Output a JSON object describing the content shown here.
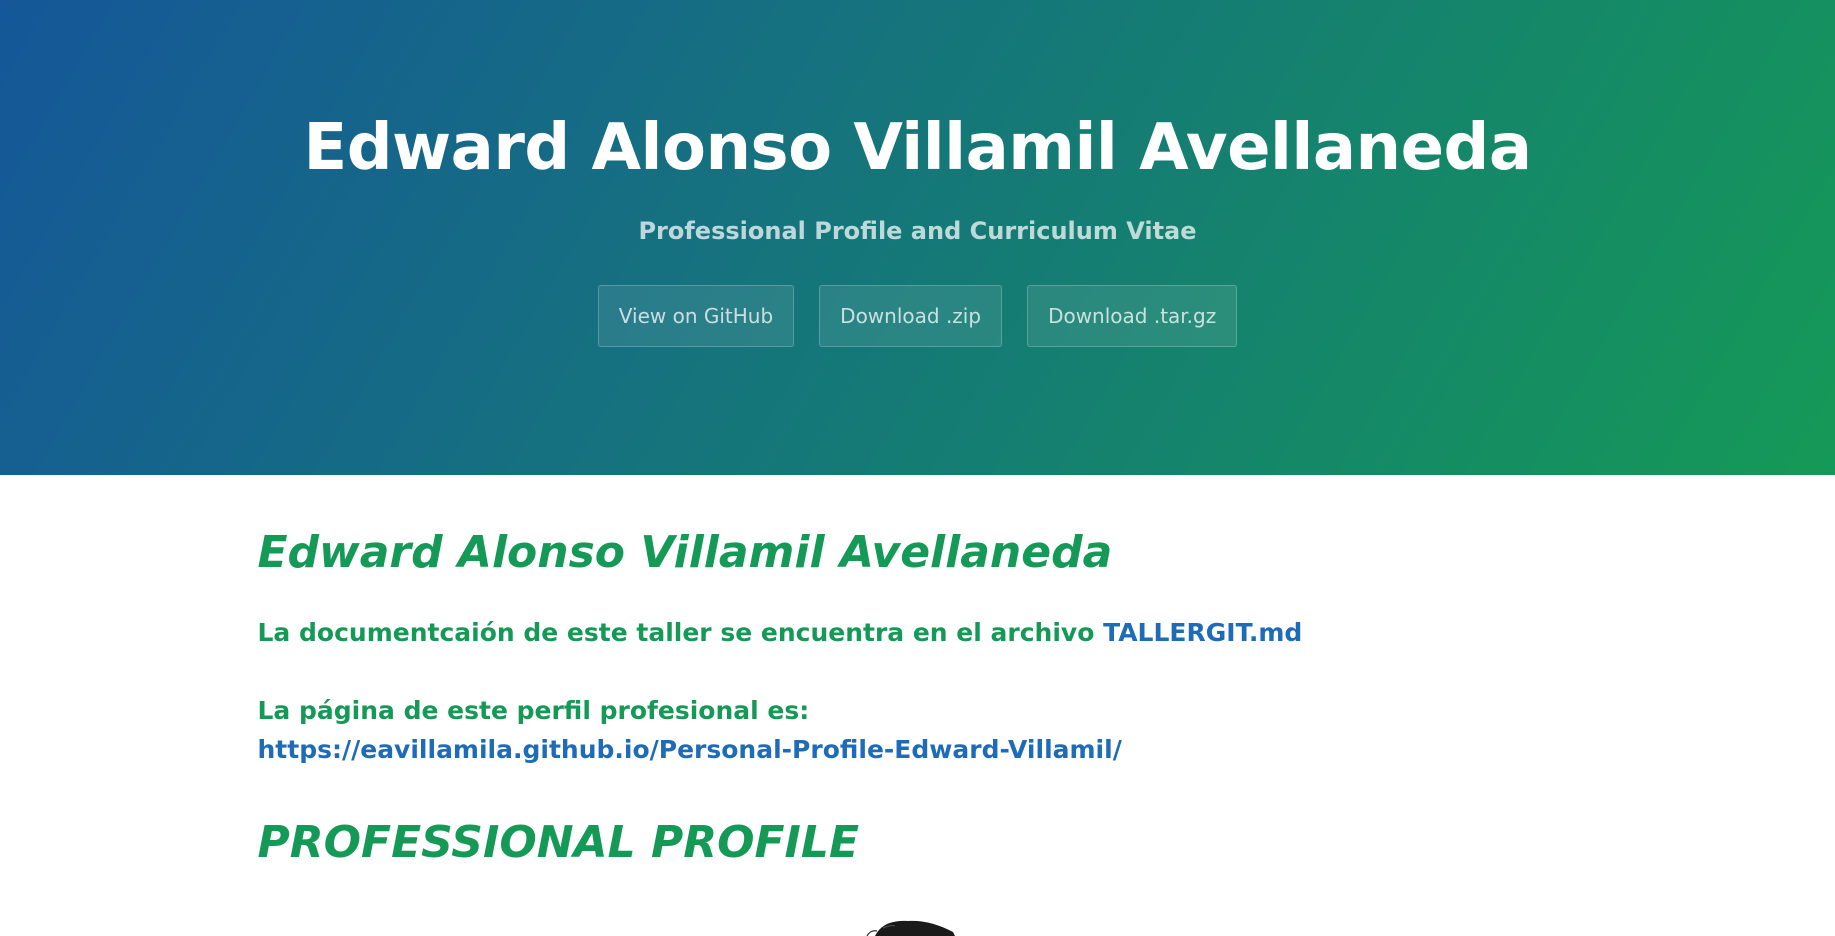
{
  "header": {
    "project_name": "Edward Alonso Villamil Avellaneda",
    "tagline": "Professional Profile and Curriculum Vitae",
    "buttons": {
      "github": "View on GitHub",
      "zip": "Download .zip",
      "targz": "Download .tar.gz"
    },
    "gradient_start": "#155799",
    "gradient_end": "#159957"
  },
  "main": {
    "title": "Edward Alonso Villamil Avellaneda",
    "doc_text": "La documentcaión de este taller se encuentra en el archivo ",
    "doc_link": "TALLERGIT.md",
    "page_text": "La página de este perfil profesional es: ",
    "page_link": "https://eavillamila.github.io/Personal-Profile-Edward-Villamil/",
    "section_heading": "PROFESSIONAL PROFILE",
    "heading_color": "#159957",
    "link_color": "#1e6bb8"
  }
}
